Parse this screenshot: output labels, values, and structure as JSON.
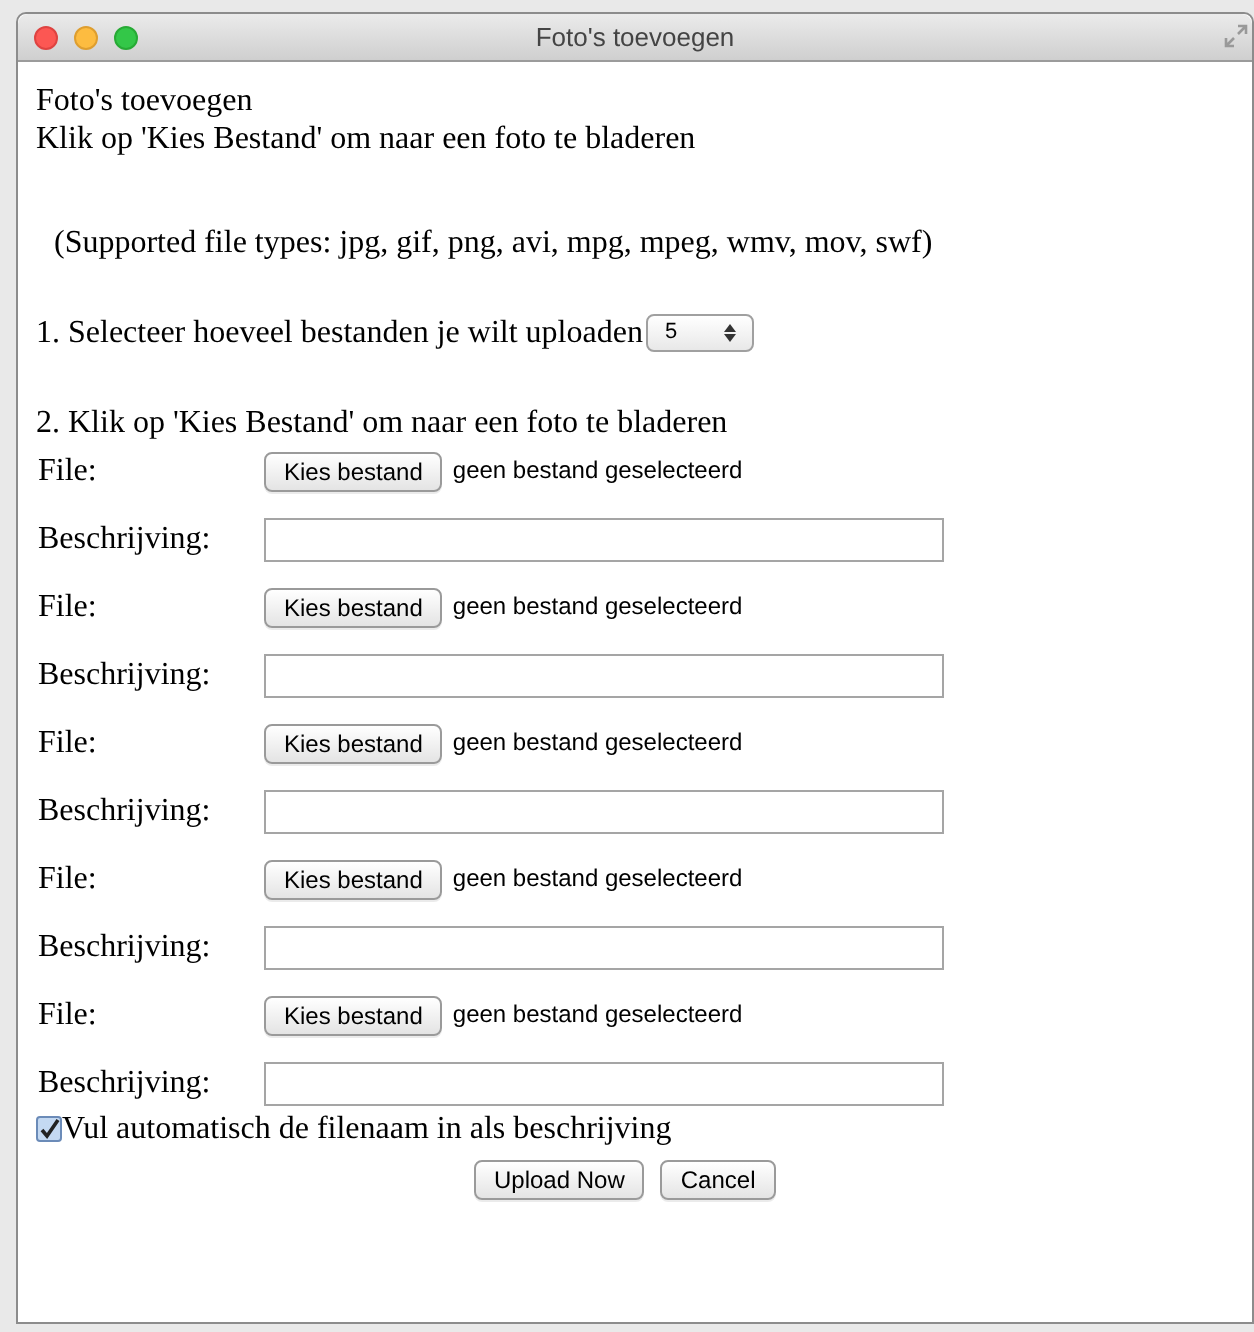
{
  "window": {
    "title": "Foto's toevoegen"
  },
  "heading": "Foto's toevoegen",
  "intro": "Klik op 'Kies Bestand' om naar een foto te bladeren",
  "supported": "(Supported file types: jpg, gif, png, avi, mpg, mpeg, wmv, mov, swf)",
  "step1": {
    "label": "1. Selecteer hoeveel bestanden je wilt uploaden",
    "count": "5"
  },
  "step2": "2. Klik op 'Kies Bestand' om naar een foto te bladeren",
  "files": [
    {
      "file_label": "File:",
      "button": "Kies bestand",
      "status": "geen bestand geselecteerd",
      "description_label": "Beschrijving:"
    },
    {
      "file_label": "File:",
      "button": "Kies bestand",
      "status": "geen bestand geselecteerd",
      "description_label": "Beschrijving:"
    },
    {
      "file_label": "File:",
      "button": "Kies bestand",
      "status": "geen bestand geselecteerd",
      "description_label": "Beschrijving:"
    },
    {
      "file_label": "File:",
      "button": "Kies bestand",
      "status": "geen bestand geselecteerd",
      "description_label": "Beschrijving:"
    },
    {
      "file_label": "File:",
      "button": "Kies bestand",
      "status": "geen bestand geselecteerd",
      "description_label": "Beschrijving:"
    }
  ],
  "autofill": {
    "label": "Vul automatisch de filenaam in als beschrijving",
    "checked": true
  },
  "buttons": [
    "Upload Now",
    "Cancel"
  ]
}
